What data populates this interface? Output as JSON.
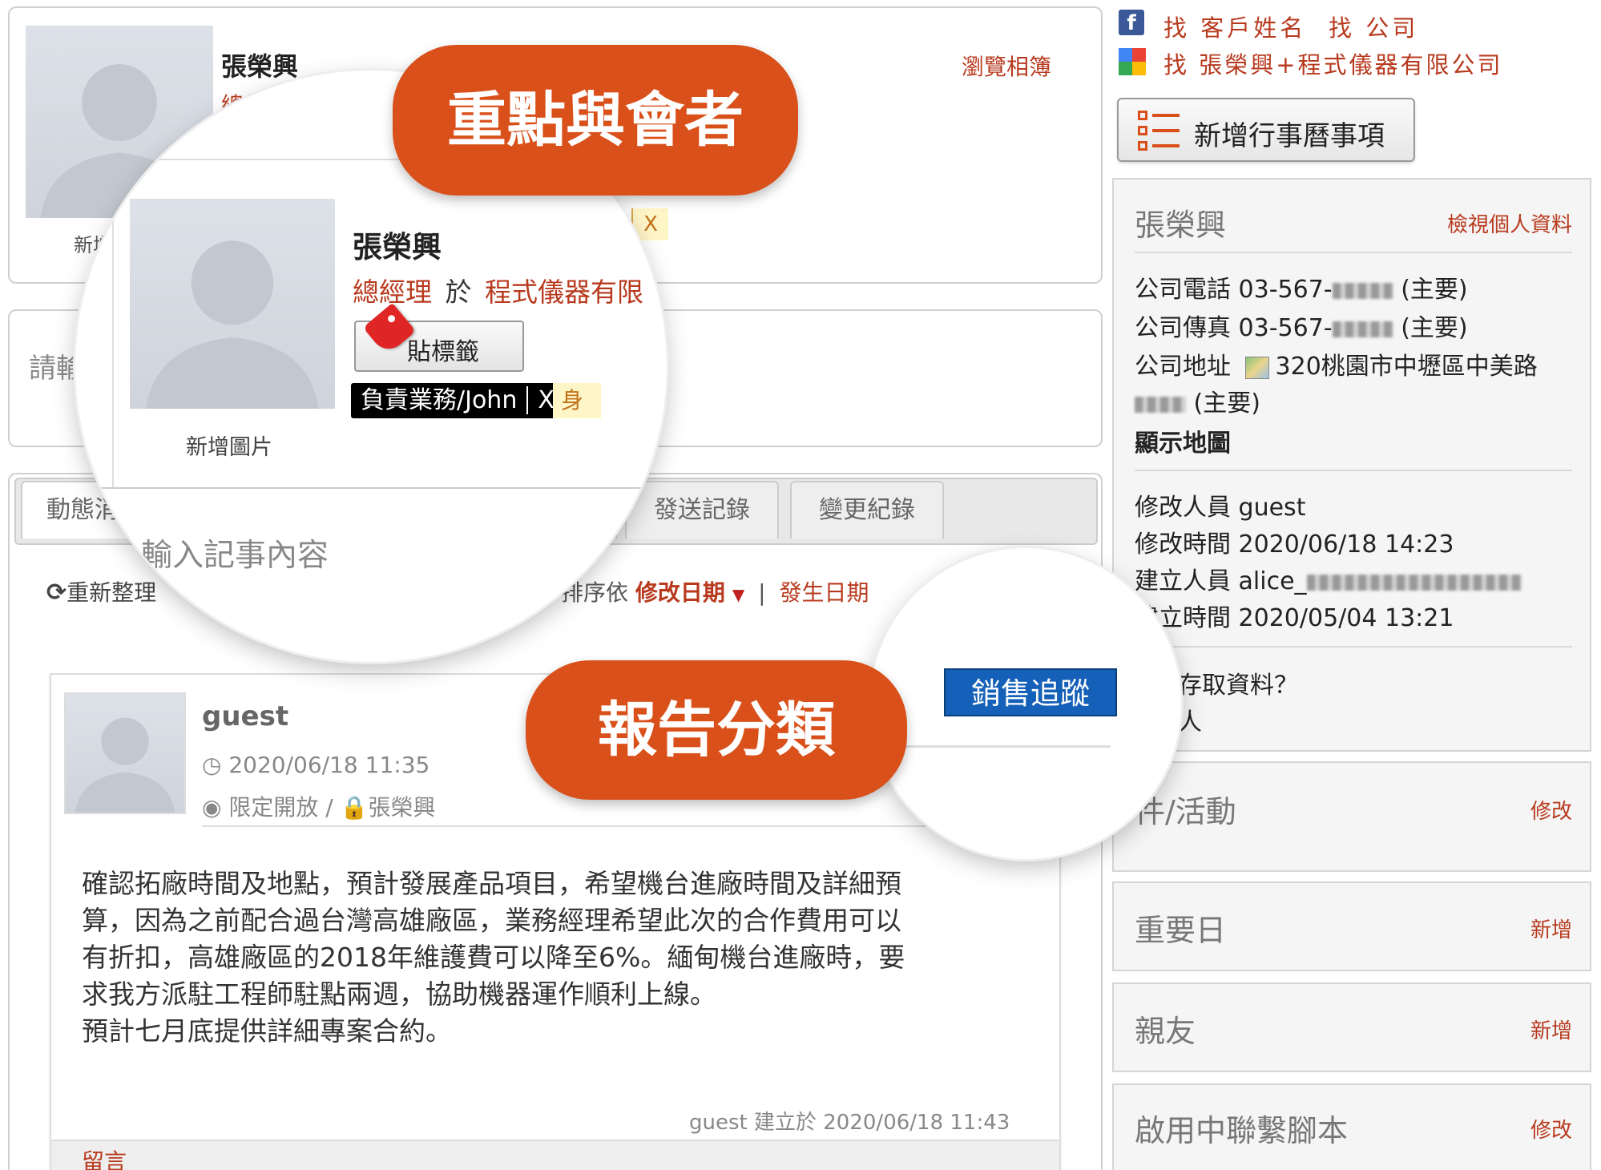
{
  "top_links": {
    "search_client": "找 客戶姓名",
    "search_company": "找 公司",
    "search_combo": "找 張榮興+程式儀器有限公司",
    "add_event_label": "新增行事曆事項"
  },
  "profile": {
    "name": "張榮興",
    "title_prefix": "總經",
    "browse_album": "瀏覽相簿",
    "add_photo_short": "新增",
    "tag_x": "X"
  },
  "magnified_profile": {
    "name": "張榮興",
    "role": "總經理",
    "at": "於",
    "company": "程式儀器有限",
    "tag_button": "貼標籤",
    "tag_owner": "負責業務/John",
    "tag_owner_x": "X",
    "tag_partial": "身",
    "add_photo": "新增圖片",
    "note_placeholder": "輸入記事內容"
  },
  "labels": {
    "key_attendees": "重點與會者",
    "report_category": "報告分類"
  },
  "note_input": {
    "prefix": "請輸"
  },
  "tabs": {
    "activity": "動態消息",
    "sent_log": "發送記錄",
    "change_log": "變更紀錄"
  },
  "sort": {
    "refresh": "重新整理",
    "sort_by": "排序依",
    "modified_date": "修改日期",
    "separator": "|",
    "occurred_date": "發生日期"
  },
  "post": {
    "author": "guest",
    "time": "2020/06/18 11:35",
    "visibility": "限定開放",
    "slash": "/",
    "restricted_to": "張榮興",
    "category": "銷售追蹤",
    "body_lines": [
      "確認拓廠時間及地點，預計發展產品項目，希望機台進廠時間及詳細預",
      "算，因為之前配合過台灣高雄廠區，業務經理希望此次的合作費用可以",
      "有折扣，高雄廠區的2018年維護費可以降至6%。緬甸機台進廠時，要",
      "求我方派駐工程師駐點兩週，協助機器運作順利上線。",
      "預計七月底提供詳細專案合約。"
    ],
    "footer_author": "guest",
    "footer_created": "建立於",
    "footer_time": "2020/06/18 11:43",
    "comment": "留言"
  },
  "contact_card": {
    "name": "張榮興",
    "view_profile": "檢視個人資料",
    "phone_label": "公司電話",
    "phone_value": "03-567-",
    "phone_main": "(主要)",
    "fax_label": "公司傳真",
    "fax_value": "03-567-",
    "fax_main": "(主要)",
    "address_label": "公司地址",
    "address_value": "320桃園市中壢區中美路",
    "address_main": "(主要)",
    "show_map": "顯示地圖",
    "modifier_label": "修改人員",
    "modifier_value": "guest",
    "modified_time_label": "修改時間",
    "modified_time_value": "2020/06/18 14:23",
    "creator_label": "建立人員",
    "creator_value": "alice_",
    "created_time_label": "建立時間",
    "created_time_value": "2020/05/04 13:21",
    "access_question": "存取資料？",
    "access_answer": "人"
  },
  "side_cards": {
    "events_title": "件/活動",
    "events_action": "修改",
    "important_title": "重要日",
    "important_action": "新增",
    "relatives_title": "親友",
    "relatives_action": "新增",
    "scripts_title": "啟用中聯繫腳本",
    "scripts_action": "修改"
  },
  "colors": {
    "accent_orange": "#d9501a",
    "link_red": "#b83a1e",
    "category_blue": "#1560b8"
  }
}
